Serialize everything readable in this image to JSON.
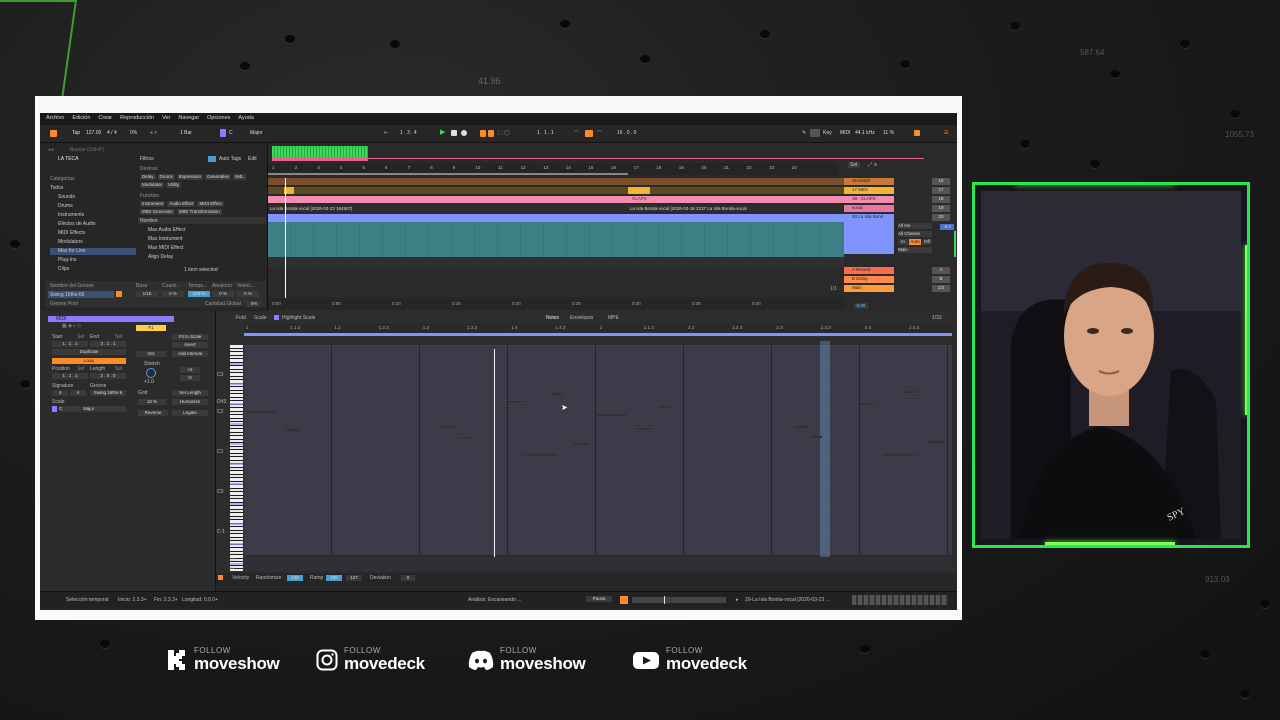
{
  "menu": [
    "Archivo",
    "Edición",
    "Crear",
    "Reproducción",
    "Ver",
    "Navegar",
    "Opciones",
    "Ayuda"
  ],
  "transport": {
    "tap": "Tap",
    "tempo": "127.00",
    "signature": "4 / 4",
    "zoom": "0%",
    "quant": "1 Bar",
    "key": "C",
    "scale": "Major",
    "position": "1 . 3 . 4",
    "loop_start": "1 . 1 . 1",
    "loop_len": "16 . 0 . 0",
    "key_label": "Key",
    "midi_label": "MIDI",
    "sample_rate": "44.1 kHz",
    "cpu": "11 %"
  },
  "browser": {
    "search_placeholder": "Buscar (Ctrl+F)",
    "collection": "LA TECA",
    "categories_title": "Categorías",
    "categories": [
      "Todos",
      "Sounds",
      "Drums",
      "Instruments",
      "Efectos de Audio",
      "MIDI Effects",
      "Modulators",
      "Max for Live",
      "Plug-Ins",
      "Clips"
    ],
    "selected_category": "Max for Live",
    "filters_label": "Filtros",
    "auto_tags": "Auto Tags",
    "edit": "Edit",
    "devices_label": "Devices",
    "tags_row1": [
      "Delay",
      "Drums",
      "Expression",
      "Generative",
      "M4L"
    ],
    "tags_row2": [
      "Modulator",
      "Utility"
    ],
    "function_label": "Function",
    "tags_row3": [
      "Instrument",
      "Audio Effect",
      "MIDI Effect"
    ],
    "tags_row4": [
      "MIDI Generator",
      "MIDI Transformation"
    ],
    "name_header": "Nombre",
    "results": [
      "Max Audio Effect",
      "Max Instrument",
      "Max MIDI Effect",
      "Align Delay"
    ],
    "items_selected": "1 item selected",
    "groove_header": "Nombre del Groove",
    "groove_cols": [
      "Base",
      "Cuanti...",
      "Tempo...",
      "Aleatorio",
      "Velocí..."
    ],
    "groove_name": "Swing 16ths-66",
    "groove_vals": [
      "1/16",
      "0 %",
      "100 %",
      "0 %",
      "0 %"
    ],
    "groove_pool": "Groove Pool",
    "global_amount_label": "Cantidad Global",
    "global_amount": "0%"
  },
  "arrangement": {
    "bars": [
      "1",
      "2",
      "3",
      "4",
      "5",
      "6",
      "7",
      "8",
      "9",
      "10",
      "11",
      "12",
      "13",
      "14",
      "15",
      "16",
      "17",
      "18",
      "19",
      "20",
      "21",
      "22",
      "23",
      "24"
    ],
    "times": [
      "0:00",
      "0:05",
      "0:10",
      "0:15",
      "0:20",
      "0:25",
      "0:30",
      "0:35",
      "0:40"
    ],
    "clip_label_a": "La Isla Bonita-vocal [2026-03-23 184507]",
    "clip_label_b": "La Isla Bonita-vocal [2026-03-18 2137 La Isla Bonita-vocal",
    "claps_clip": "CLAPS",
    "set_label": "Set",
    "page": "1/1",
    "tracks": [
      {
        "name": "SHAKER",
        "color": "#c67a3a",
        "num": "16"
      },
      {
        "name": "17 MIDI",
        "color": "#f0b537",
        "num": "17"
      },
      {
        "name": "18 - CLAPS",
        "color": "#f28db0",
        "num": "18"
      },
      {
        "name": "vocal",
        "color": "#e978a0",
        "num": "19"
      },
      {
        "name": "20 La Isla Bonit",
        "color": "#7f94ff",
        "num": "20"
      },
      {
        "name": "A Reverb",
        "color": "#ff6a4a",
        "num": "A"
      },
      {
        "name": "B Delay",
        "color": "#ff8a4a",
        "num": "B"
      },
      {
        "name": "Main",
        "color": "#ff9b3a",
        "num": "1/2"
      }
    ],
    "mixer": {
      "input": "All Ins",
      "channel": "All Channe",
      "in": "In",
      "auto": "Auto",
      "off": "Off",
      "main": "Main",
      "master_vol": "-6.0",
      "tempo_out": "0.00"
    }
  },
  "clip": {
    "name": "MIDI",
    "start_label": "Start",
    "set": "Set",
    "end_label": "End",
    "start_val": "1 . 1 . 1",
    "end_val": "3 . 1 . 1",
    "duplicate": "Duplicate",
    "loop": "Loop",
    "position_label": "Position",
    "length_label": "Length",
    "pos_val": "1 . 1 . 1",
    "len_val": "2 . 0 . 0",
    "signature_label": "Signature",
    "groove_label": "Groove",
    "sig_num": "4",
    "sig_den": "4",
    "groove_val": "Swing 16ths-6",
    "scale_label": "Scale",
    "scale_key": "C",
    "scale_name": "Major",
    "fit_to_scale": "Fit to Scale",
    "invert": "Invert",
    "f1": "F1",
    "add_interval": "Add Interval",
    "oct": "Oct",
    "stretch": "Stretch",
    "stretch_val": "+1.0",
    "x2": "×2",
    "div2": "/2",
    "grid": "Grid",
    "set_length": "Set Length",
    "grid_pct": "10 %",
    "humanize": "Humanize",
    "reverse": "Reverse",
    "legato": "Legato"
  },
  "piano": {
    "fold": "Fold",
    "scale": "Scale",
    "highlight_scale": "Highlight Scale",
    "tabs": [
      "Notes",
      "Envelopes",
      "MPE"
    ],
    "grid_res": "1/32",
    "ruler": [
      "1",
      "1.1.3",
      "1.2",
      "1.2.3",
      "1.3",
      "1.3.3",
      "1.4",
      "1.4.3",
      "2",
      "2.1.3",
      "2.2",
      "2.2.3",
      "2.3",
      "2.3.3",
      "2.4",
      "2.4.3"
    ],
    "octaves": [
      "C3",
      "C2",
      "C1",
      "C0",
      "C-1"
    ],
    "sharp_label": "D#3",
    "velocity_label": "Velocity",
    "randomize": "Randomize",
    "rand_val": "100",
    "ramp": "Ramp",
    "ramp_val": "100",
    "vel_val": "127",
    "deviation": "Deviation",
    "dev_val": "0",
    "vel_top": "127",
    "vel_bot": "64"
  },
  "status": {
    "selection": "Selección temporal",
    "start": "Inicio: 2.3.3+",
    "end": "Fin: 2.3.3+",
    "length": "Longitud: 0.0.0+",
    "analysis": "Análisis: Escaneando ...",
    "pause": "Pausa",
    "clip": "20-La Isla Bonita-vocal [2026-03-23 ..."
  },
  "background_numbers": [
    "41.96",
    "587.64",
    "1055.73",
    "913.03"
  ],
  "footer": [
    {
      "icon": "kick-icon",
      "follow": "FOLLOW",
      "handle": "moveshow"
    },
    {
      "icon": "instagram-icon",
      "follow": "FOLLOW",
      "handle": "movedeck"
    },
    {
      "icon": "discord-icon",
      "follow": "FOLLOW",
      "handle": "moveshow"
    },
    {
      "icon": "youtube-icon",
      "follow": "FOLLOW",
      "handle": "movedeck"
    }
  ],
  "colors": {
    "accent_green": "#5dff3c",
    "ableton_orange": "#ff8a28",
    "note_purple": "#9aa3ff"
  }
}
